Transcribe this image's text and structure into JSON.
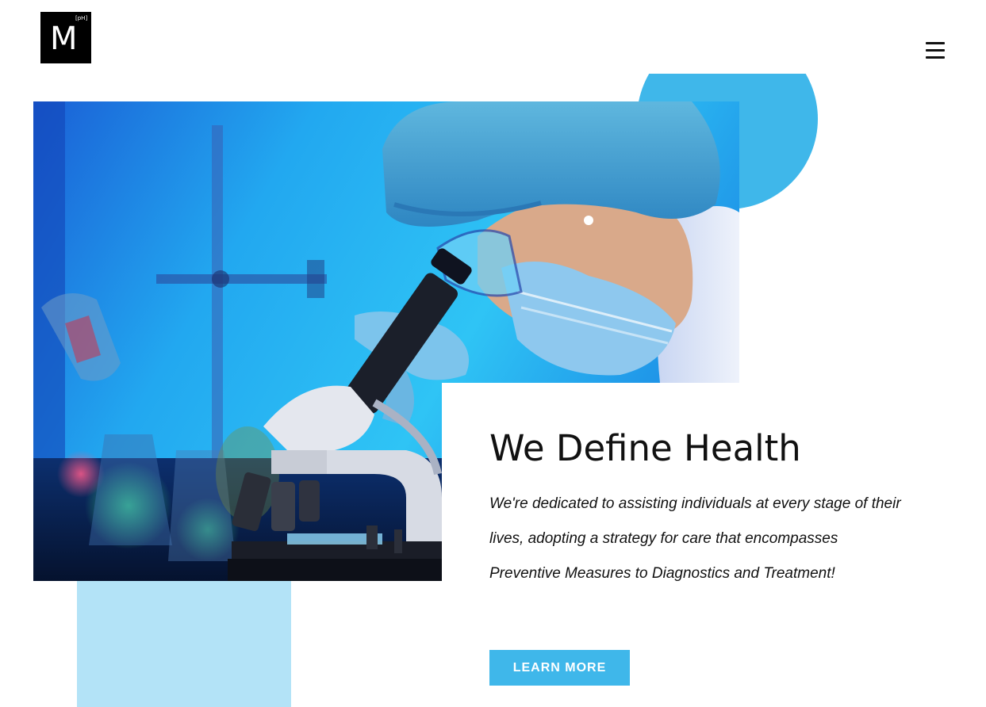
{
  "header": {
    "logo_letter": "M",
    "logo_sup": "[pH]",
    "menu_icon": "hamburger-menu-icon"
  },
  "hero": {
    "image_icon": "lab-scientist-microscope-photo",
    "headline": "We Define Health",
    "tagline": "We're dedicated to assisting individuals at every stage of their lives, adopting a strategy for care that encompasses Preventive Measures to Diagnostics and Treatment!",
    "cta_label": "LEARN MORE"
  },
  "colors": {
    "accent": "#3fb7ea",
    "accent_light": "#b3e3f7",
    "text": "#111111",
    "background": "#ffffff"
  }
}
